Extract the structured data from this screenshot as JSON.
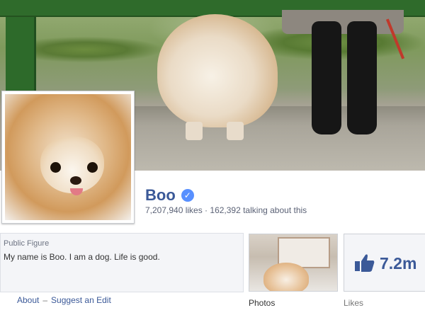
{
  "page": {
    "name": "Boo",
    "stats": "7,207,940 likes · 162,392 talking about this",
    "about": {
      "category": "Public Figure",
      "description": "My name is Boo. I am a dog. Life is good."
    },
    "links": {
      "about": "About",
      "separator": "–",
      "suggest_edit": "Suggest an Edit"
    },
    "tiles": {
      "photos_label": "Photos",
      "likes_count": "7.2m",
      "likes_label": "Likes"
    }
  },
  "colors": {
    "link": "#3b5998",
    "verified": "#5890ff"
  },
  "icons": {
    "verified": "check-badge-icon",
    "likes": "thumbs-up-icon"
  }
}
